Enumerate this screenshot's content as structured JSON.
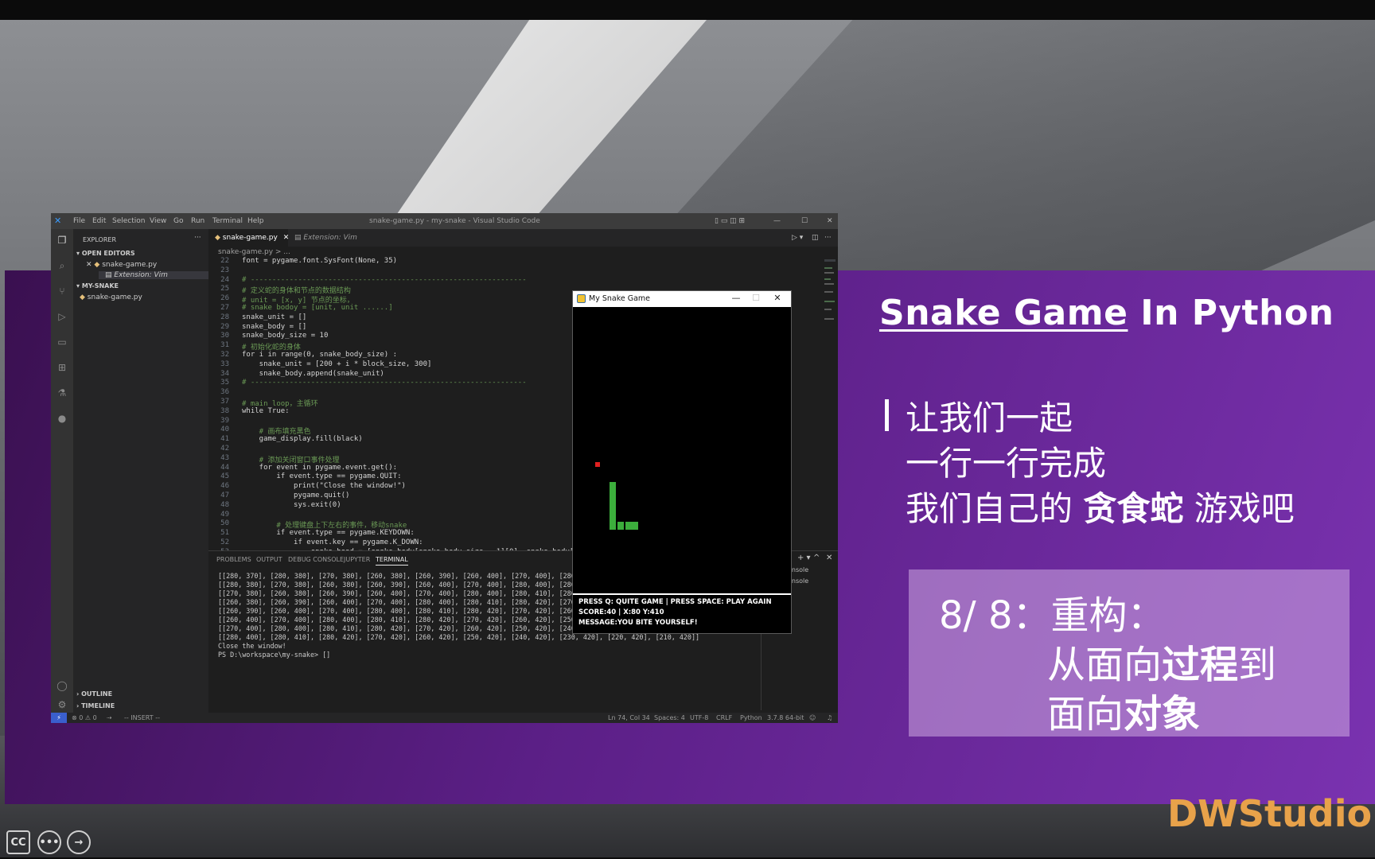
{
  "slide": {
    "title_part1": "Snake Game",
    "title_part2": " In Python",
    "lead_line1": "让我们一起",
    "lead_line2": "一行一行完成",
    "lead_line3a": "我们自己的 ",
    "lead_line3b": "贪食蛇",
    "lead_line3c": " 游戏吧",
    "panel_line1": "8/ 8：重构：",
    "panel_line2a": "从面向",
    "panel_line2b": "过程",
    "panel_line2c": "到",
    "panel_line3a": "面向",
    "panel_line3b": "对象",
    "brand": "DWStudio"
  },
  "player": {
    "cc_label": "CC",
    "more_label": "•••",
    "next_label": "→"
  },
  "vscode": {
    "menu": [
      "File",
      "Edit",
      "Selection",
      "View",
      "Go",
      "Run",
      "Terminal",
      "Help"
    ],
    "window_title": "snake-game.py - my-snake - Visual Studio Code",
    "explorer_label": "EXPLORER",
    "open_editors_label": "OPEN EDITORS",
    "open_editor_1": "snake-game.py",
    "open_editor_2": "Extension: Vim",
    "folder_label": "MY-SNAKE",
    "folder_file": "snake-game.py",
    "outline_label": "OUTLINE",
    "timeline_label": "TIMELINE",
    "tab_active": "snake-game.py",
    "tab_2": "Extension: Vim",
    "breadcrumb": "snake-game.py > ...",
    "code_lines": [
      {
        "n": "22",
        "t": "font = pygame.font.SysFont(None, 35)"
      },
      {
        "n": "23",
        "t": ""
      },
      {
        "n": "24",
        "t": "# ----------------------------------------------------------------"
      },
      {
        "n": "25",
        "t": "# 定义蛇的身体和节点的数据结构"
      },
      {
        "n": "26",
        "t": "# unit = [x, y] 节点的坐标，"
      },
      {
        "n": "27",
        "t": "# snake bodoy = [unit, unit ......]"
      },
      {
        "n": "28",
        "t": "snake_unit = []"
      },
      {
        "n": "29",
        "t": "snake_body = []"
      },
      {
        "n": "30",
        "t": "snake_body_size = 10"
      },
      {
        "n": "31",
        "t": "# 初始化蛇的身体"
      },
      {
        "n": "32",
        "t": "for i in range(0, snake_body_size) :"
      },
      {
        "n": "33",
        "t": "    snake_unit = [200 + i * block_size, 300]"
      },
      {
        "n": "34",
        "t": "    snake_body.append(snake_unit)"
      },
      {
        "n": "35",
        "t": "# ----------------------------------------------------------------"
      },
      {
        "n": "36",
        "t": ""
      },
      {
        "n": "37",
        "t": "# main loop，主循环"
      },
      {
        "n": "38",
        "t": "while True:"
      },
      {
        "n": "39",
        "t": ""
      },
      {
        "n": "40",
        "t": "    # 画布填充黑色"
      },
      {
        "n": "41",
        "t": "    game_display.fill(black)"
      },
      {
        "n": "42",
        "t": ""
      },
      {
        "n": "43",
        "t": "    # 添加关闭窗口事件处理"
      },
      {
        "n": "44",
        "t": "    for event in pygame.event.get():"
      },
      {
        "n": "45",
        "t": "        if event.type == pygame.QUIT:"
      },
      {
        "n": "46",
        "t": "            print(\"Close the window!\")"
      },
      {
        "n": "47",
        "t": "            pygame.quit()"
      },
      {
        "n": "48",
        "t": "            sys.exit(0)"
      },
      {
        "n": "49",
        "t": ""
      },
      {
        "n": "50",
        "t": "        # 处理键盘上下左右的事件，移动snake"
      },
      {
        "n": "51",
        "t": "        if event.type == pygame.KEYDOWN:"
      },
      {
        "n": "52",
        "t": "            if event.key == pygame.K_DOWN:"
      },
      {
        "n": "53",
        "t": "                snake head = [snake body[snake body size - 1][0], snake body["
      }
    ],
    "panel_tabs": [
      "PROBLEMS",
      "OUTPUT",
      "DEBUG CONSOLE",
      "JUPYTER",
      "TERMINAL"
    ],
    "terminal_lines": [
      "[[280, 370], [280, 380], [270, 380], [260, 380], [260, 390], [260, 400], [270, 400], [280, 400], [",
      "[[280, 380], [270, 380], [260, 380], [260, 390], [260, 400], [270, 400], [280, 400], [280, 410], [",
      "[[270, 380], [260, 380], [260, 390], [260, 400], [270, 400], [280, 400], [280, 410], [280, 420], [270, 420], [260, 420]]",
      "[[260, 380], [260, 390], [260, 400], [270, 400], [280, 400], [280, 410], [280, 420], [270, 420], [260, 420], [250, 420]]",
      "[[260, 390], [260, 400], [270, 400], [280, 400], [280, 410], [280, 420], [270, 420], [260, 420], [250, 420], [240, 420]]",
      "[[260, 400], [270, 400], [280, 400], [280, 410], [280, 420], [270, 420], [260, 420], [250, 420], [240, 420], [230, 420]]",
      "[[270, 400], [280, 400], [280, 410], [280, 420], [270, 420], [260, 420], [250, 420], [240, 420], [230, 420], [220, 420]]",
      "[[280, 400], [280, 410], [280, 420], [270, 420], [260, 420], [250, 420], [240, 420], [230, 420], [220, 420], [210, 420]]",
      "Close the window!",
      "PS D:\\workspace\\my-snake> []"
    ],
    "side_console_1": "onsole",
    "side_console_2": "onsole",
    "status": {
      "errors": "⊗ 0 ⚠ 0",
      "mode": "-- INSERT --",
      "position": "Ln 74, Col 34",
      "spaces": "Spaces: 4",
      "encoding": "UTF-8",
      "eol": "CRLF",
      "language": "Python",
      "interpreter": "3.7.8 64-bit"
    }
  },
  "game": {
    "title": "My Snake Game",
    "info_line1": "PRESS Q: QUITE GAME | PRESS SPACE: PLAY AGAIN",
    "info_line2": "SCORE:40 | X:80 Y:410",
    "info_line3": "MESSAGE:YOU BITE YOURSELF!",
    "snake_color": "#3cae3c",
    "food_color": "#e02020"
  }
}
